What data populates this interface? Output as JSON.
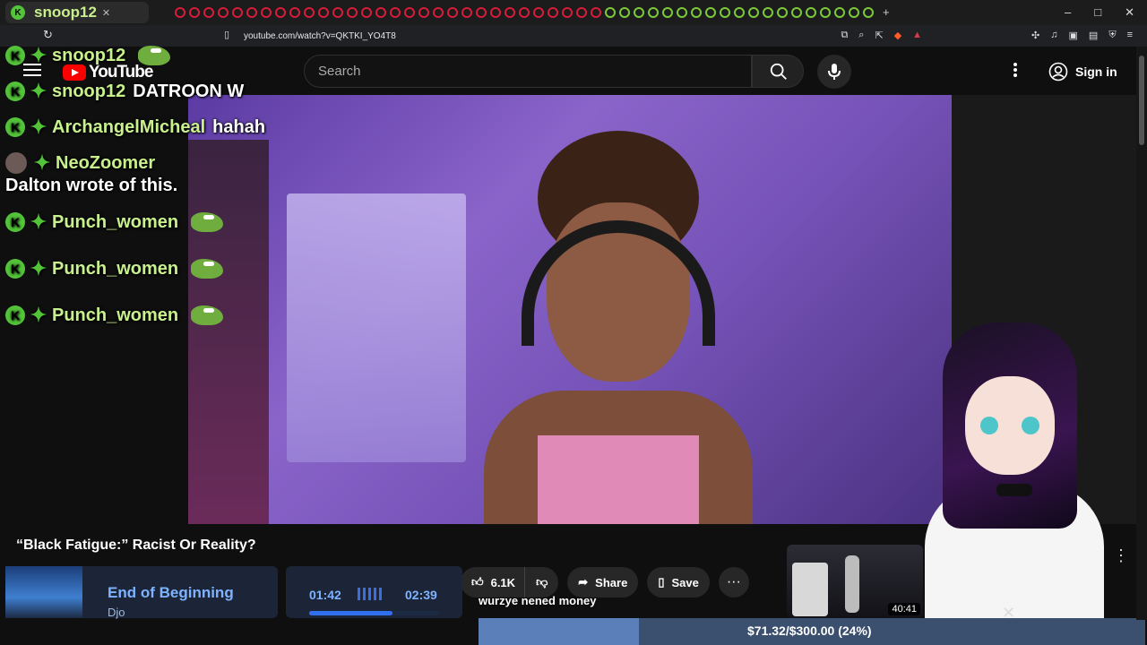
{
  "browser": {
    "tab_title": "snoop12",
    "url": "youtube.com/watch?v=QKTKI_YO4T8",
    "window_controls": {
      "minimize": "–",
      "maximize": "□",
      "close": "✕"
    },
    "new_tab": "+"
  },
  "youtube": {
    "logo_text": "YouTube",
    "search_placeholder": "Search",
    "sign_in_label": "Sign in",
    "video_title": "“Black Fatigue:” Racist Or Reality?",
    "actions": {
      "like_count": "6.1K",
      "share_label": "Share",
      "save_label": "Save",
      "more_label": "···"
    },
    "suggested_duration": "40:41"
  },
  "chat": [
    {
      "user": "snoop12",
      "message": "",
      "badge": "kick",
      "emote": true
    },
    {
      "user": "snoop12",
      "message": "DATROON W",
      "badge": "kick",
      "emote": false
    },
    {
      "user": "ArchangelMicheal",
      "message": "hahah",
      "badge": "kick",
      "emote": false
    },
    {
      "user": "NeoZoomer",
      "message": "",
      "badge": "avatar",
      "emote": false
    },
    {
      "user": "",
      "message": "Dalton wrote of this.",
      "badge": "none",
      "emote": false
    },
    {
      "user": "Punch_women",
      "message": "",
      "badge": "kick",
      "emote": true
    },
    {
      "user": "Punch_women",
      "message": "",
      "badge": "kick",
      "emote": true
    },
    {
      "user": "Punch_women",
      "message": "",
      "badge": "kick",
      "emote": true
    }
  ],
  "music": {
    "song": "End of Beginning",
    "artist": "Djo"
  },
  "timer": {
    "elapsed": "01:42",
    "total": "02:39",
    "progress": 0.64
  },
  "donation_message": "wurzye nened money",
  "goal": {
    "text": "$71.32/$300.00 (24%)",
    "progress": 0.24
  },
  "colors": {
    "chat_username": "#c8f08c",
    "kick_green": "#53c33a",
    "widget_blue": "#7fb3ff",
    "yt_red": "#ff0000"
  }
}
